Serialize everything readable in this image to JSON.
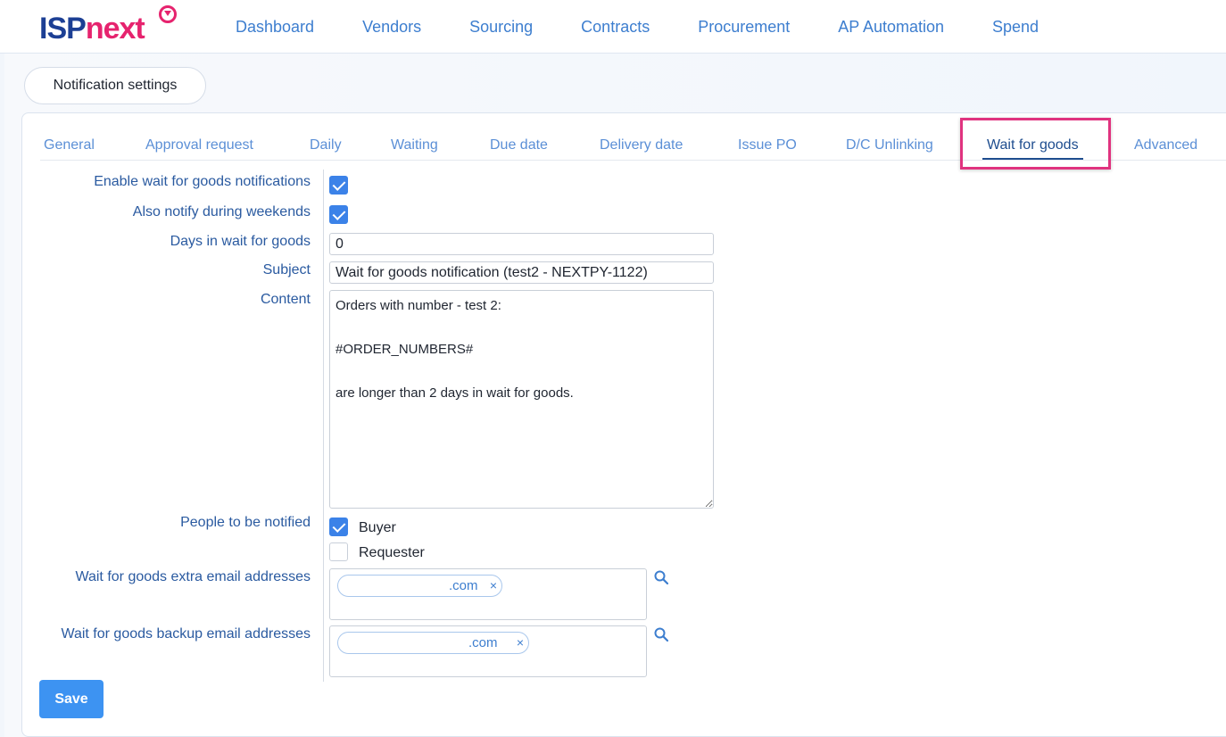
{
  "brand": {
    "logo_left": "ISP",
    "logo_right": "next"
  },
  "nav": [
    "Dashboard",
    "Vendors",
    "Sourcing",
    "Contracts",
    "Procurement",
    "AP Automation",
    "Spend"
  ],
  "page": {
    "title": "Notification settings"
  },
  "tabs": [
    "General",
    "Approval request",
    "Daily",
    "Waiting",
    "Due date",
    "Delivery date",
    "Issue PO",
    "D/C Unlinking",
    "Wait for goods",
    "Advanced"
  ],
  "active_tab": "Wait for goods",
  "form": {
    "enable_label": "Enable wait for goods notifications",
    "enable_checked": true,
    "weekends_label": "Also notify during weekends",
    "weekends_checked": true,
    "days_label": "Days in wait for goods",
    "days_value": "0",
    "subject_label": "Subject",
    "subject_value": "Wait for goods notification (test2 - NEXTPY-1122)",
    "content_label": "Content",
    "content_value": "Orders with number - test 2:\n\n#ORDER_NUMBERS#\n\nare longer than 2 days in wait for goods.",
    "people_label": "People to be notified",
    "buyer_label": "Buyer",
    "buyer_checked": true,
    "requester_label": "Requester",
    "requester_checked": false,
    "extra_label": "Wait for goods extra email addresses",
    "extra_tag": ".com",
    "backup_label": "Wait for goods backup email addresses",
    "backup_tag": ".com",
    "tag_remove": "×"
  },
  "actions": {
    "save_label": "Save"
  },
  "colors": {
    "accent": "#3d93f2",
    "brand_blue": "#1c3f94",
    "brand_pink": "#e6236e",
    "highlight": "#e0337f"
  },
  "icons": {
    "search": "search-icon",
    "checkmark": "checkmark-icon",
    "remove": "close-icon"
  }
}
